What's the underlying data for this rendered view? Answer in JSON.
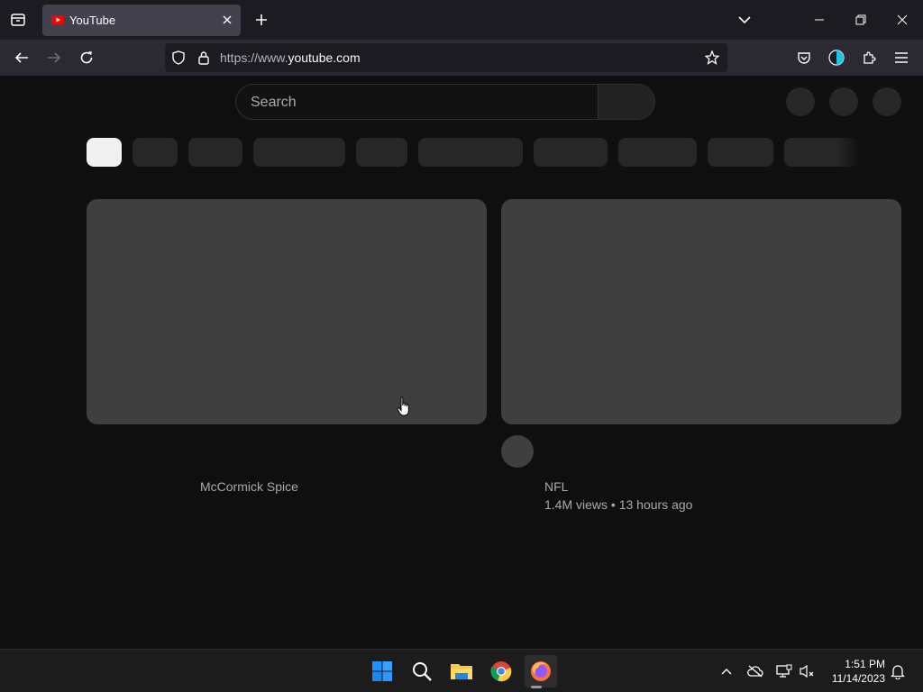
{
  "browser": {
    "tab": {
      "title": "YouTube",
      "favicon": "youtube-favicon-icon"
    },
    "url": {
      "prefix": "https://www.",
      "host": "youtube.com",
      "suffix": ""
    }
  },
  "youtube": {
    "search": {
      "placeholder": "Search"
    },
    "videos": [
      {
        "channel": "McCormick Spice",
        "stats": ""
      },
      {
        "channel": "NFL",
        "stats": "1.4M views • 13 hours ago"
      }
    ]
  },
  "taskbar": {
    "clock": {
      "time": "1:51 PM",
      "date": "11/14/2023"
    },
    "pinned": [
      "start-icon",
      "search-icon",
      "file-explorer-icon",
      "chrome-icon",
      "firefox-icon"
    ]
  },
  "colors": {
    "youtube_red": "#ff0000",
    "page_bg": "#0f0f0f",
    "placeholder": "#3f3f3f"
  }
}
